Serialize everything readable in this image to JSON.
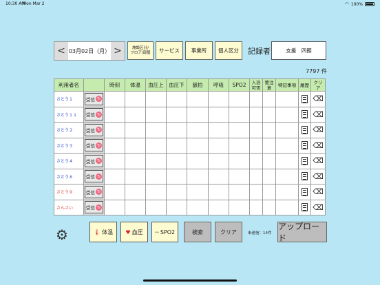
{
  "status": {
    "time": "10:30 AM",
    "date": "Mon Mar 2",
    "battery": "100%"
  },
  "date_nav": {
    "prev": "<",
    "next": ">",
    "date": "03月02日（月）"
  },
  "toolbar": {
    "facility": "施設区分/\nフロア/部屋",
    "service": "サービス",
    "office": "事業所",
    "personal": "個人区分"
  },
  "recorder": {
    "label": "記録者",
    "name": "支援　四朗"
  },
  "record_count": "7797 件",
  "table": {
    "headers": [
      "利用者名",
      "",
      "時刻",
      "体温",
      "血圧上",
      "血圧下",
      "脈拍",
      "呼吸",
      "SPO2",
      "入浴\n可否",
      "要注\n意",
      "特記事項",
      "履歴",
      "クリ\nア"
    ],
    "rows": [
      {
        "name": "さとう１",
        "recv": "受信",
        "red": false
      },
      {
        "name": "さとう１１",
        "recv": "受信",
        "red": false
      },
      {
        "name": "さとう２",
        "recv": "受信",
        "red": false
      },
      {
        "name": "さとう３",
        "recv": "受信",
        "red": false
      },
      {
        "name": "さとう４",
        "recv": "受信",
        "red": false
      },
      {
        "name": "さとう８",
        "recv": "受信",
        "red": false
      },
      {
        "name": "さとう９",
        "recv": "受信",
        "red": true
      },
      {
        "name": "さんさい",
        "recv": "受信",
        "red": true
      }
    ]
  },
  "bottom": {
    "settings_icon": "gear-icon",
    "temp": "体温",
    "bp": "血圧",
    "spo2": "SPO2",
    "search": "検索",
    "clear": "クリア",
    "unsent": "未送信：14件",
    "upload": "アップロード"
  }
}
